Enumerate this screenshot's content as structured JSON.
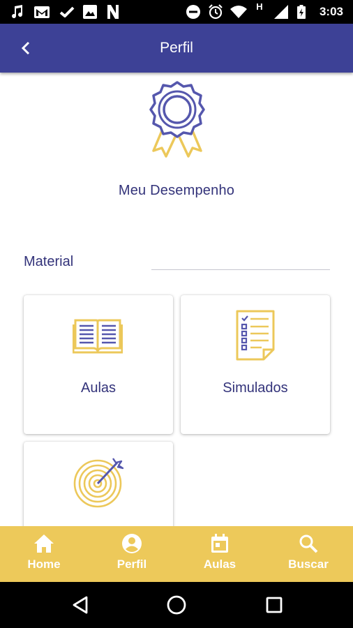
{
  "status_bar": {
    "time": "3:03",
    "network_label": "H",
    "left_icons": [
      "music-note-icon",
      "gmail-icon",
      "check-icon",
      "image-icon",
      "n-icon"
    ],
    "right_icons": [
      "do-not-disturb-icon",
      "alarm-icon",
      "wifi-icon",
      "signal-icon",
      "battery-icon"
    ]
  },
  "app_bar": {
    "title": "Perfil",
    "background": "#3d4196"
  },
  "hero": {
    "label": "Meu Desempenho",
    "icon": "award-ribbon-icon"
  },
  "section": {
    "title": "Material"
  },
  "cards": [
    {
      "label": "Aulas",
      "icon": "open-book-icon"
    },
    {
      "label": "Simulados",
      "icon": "checklist-icon"
    },
    {
      "label": "",
      "icon": "target-arrow-icon"
    }
  ],
  "bottom_nav": {
    "background": "#edc95a",
    "items": [
      {
        "label": "Home",
        "icon": "home-icon"
      },
      {
        "label": "Perfil",
        "icon": "account-circle-icon",
        "active": true
      },
      {
        "label": "Aulas",
        "icon": "calendar-icon"
      },
      {
        "label": "Buscar",
        "icon": "search-icon"
      }
    ]
  },
  "system_nav": [
    "back-triangle-icon",
    "home-circle-icon",
    "recents-square-icon"
  ]
}
